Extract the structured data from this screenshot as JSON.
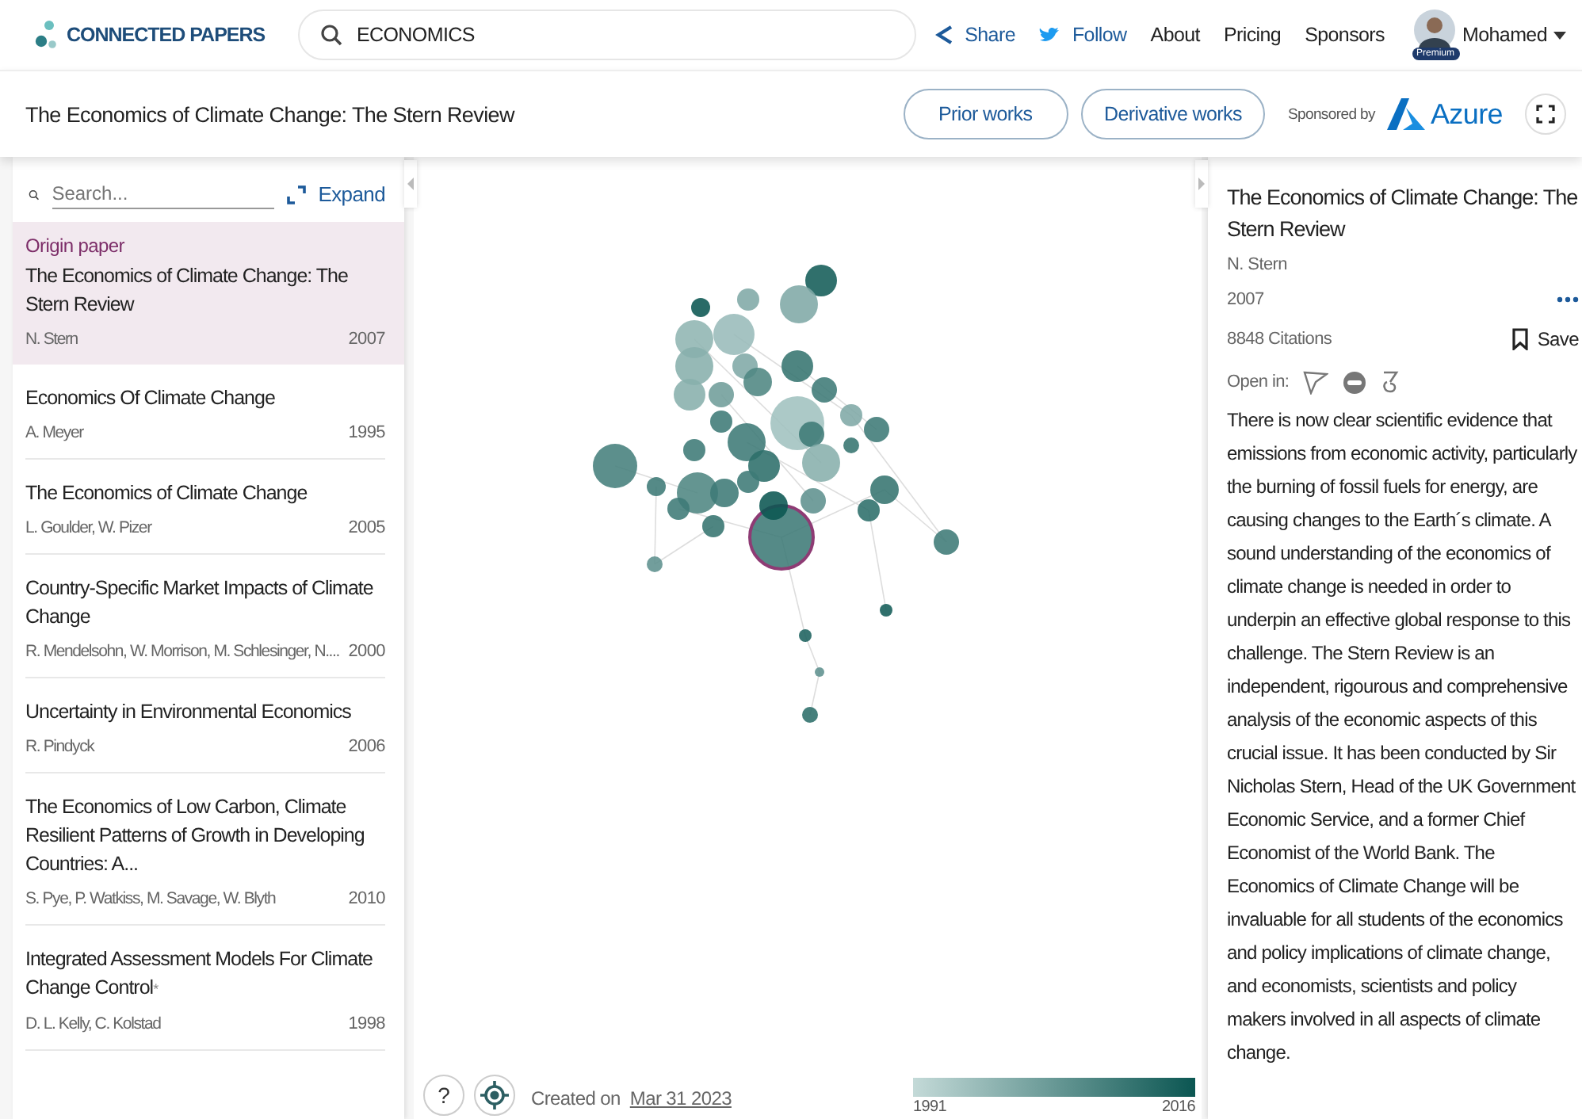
{
  "header": {
    "logo": "CONNECTED PAPERS",
    "search_value": "ECONOMICS",
    "links": [
      {
        "kind": "share",
        "label": "Share"
      },
      {
        "kind": "follow",
        "label": "Follow"
      },
      {
        "kind": "plain",
        "label": "About"
      },
      {
        "kind": "plain",
        "label": "Pricing"
      },
      {
        "kind": "plain",
        "label": "Sponsors"
      }
    ],
    "user": {
      "name": "Mohamed",
      "badge": "Premium"
    }
  },
  "title_bar": {
    "title": "The Economics of Climate Change: The Stern Review",
    "buttons": [
      "Prior works",
      "Derivative works"
    ],
    "sponsor_label": "Sponsored by",
    "sponsor": "Azure"
  },
  "sidebar": {
    "search_placeholder": "Search...",
    "expand": "Expand",
    "items": [
      {
        "tag": "Origin paper",
        "title": "The Economics of Climate Change: The Stern Review",
        "authors": "N. Stern",
        "year": "2007",
        "selected": true
      },
      {
        "title": "Economics Of Climate Change",
        "authors": "A. Meyer",
        "year": "1995",
        "selected": false
      },
      {
        "title": "The Economics of Climate Change",
        "authors": "L. Goulder, W. Pizer",
        "year": "2005",
        "selected": false
      },
      {
        "title": "Country-Specific Market Impacts of Climate Change",
        "authors": "R. Mendelsohn, W. Morrison, M. Schlesinger, N....",
        "year": "2000",
        "selected": false
      },
      {
        "title": "Uncertainty in Environmental Economics",
        "authors": "R. Pindyck",
        "year": "2006",
        "selected": false
      },
      {
        "title": "The Economics of Low Carbon, Climate Resilient Patterns of Growth in Developing Countries: A...",
        "authors": "S. Pye, P. Watkiss, M. Savage, W. Blyth",
        "year": "2010",
        "selected": false
      },
      {
        "title": "Integrated Assessment Models For Climate Change Control",
        "mark": "*",
        "authors": "D. L. Kelly, C. Kolstad",
        "year": "1998",
        "selected": false
      }
    ]
  },
  "graph": {
    "help": "?",
    "created_label": "Created on",
    "created_date": "Mar 31 2023",
    "legend": {
      "start": "1991",
      "end": "2016"
    }
  },
  "details": {
    "title": "The Economics of Climate Change: The Stern Review",
    "authors": "N. Stern",
    "year": "2007",
    "citations": "8848 Citations",
    "save": "Save",
    "open_in": "Open in:",
    "abstract": "There is now clear scientific evidence that emissions from economic activity, particularly the burning of fossil fuels for energy, are causing changes to the Earth´s climate. A sound understanding of the economics of climate change is needed in order to underpin an effective global response to this challenge. The Stern Review is an independent, rigourous and comprehensive analysis of the economic aspects of this crucial issue. It has been conducted by Sir Nicholas Stern, Head of the UK Government Economic Service, and a former Chief Economist of the World Bank. The Economics of Climate Change will be invaluable for all students of the economics and policy implications of climate change, and economists, scientists and policy makers involved in all aspects of climate change."
  }
}
